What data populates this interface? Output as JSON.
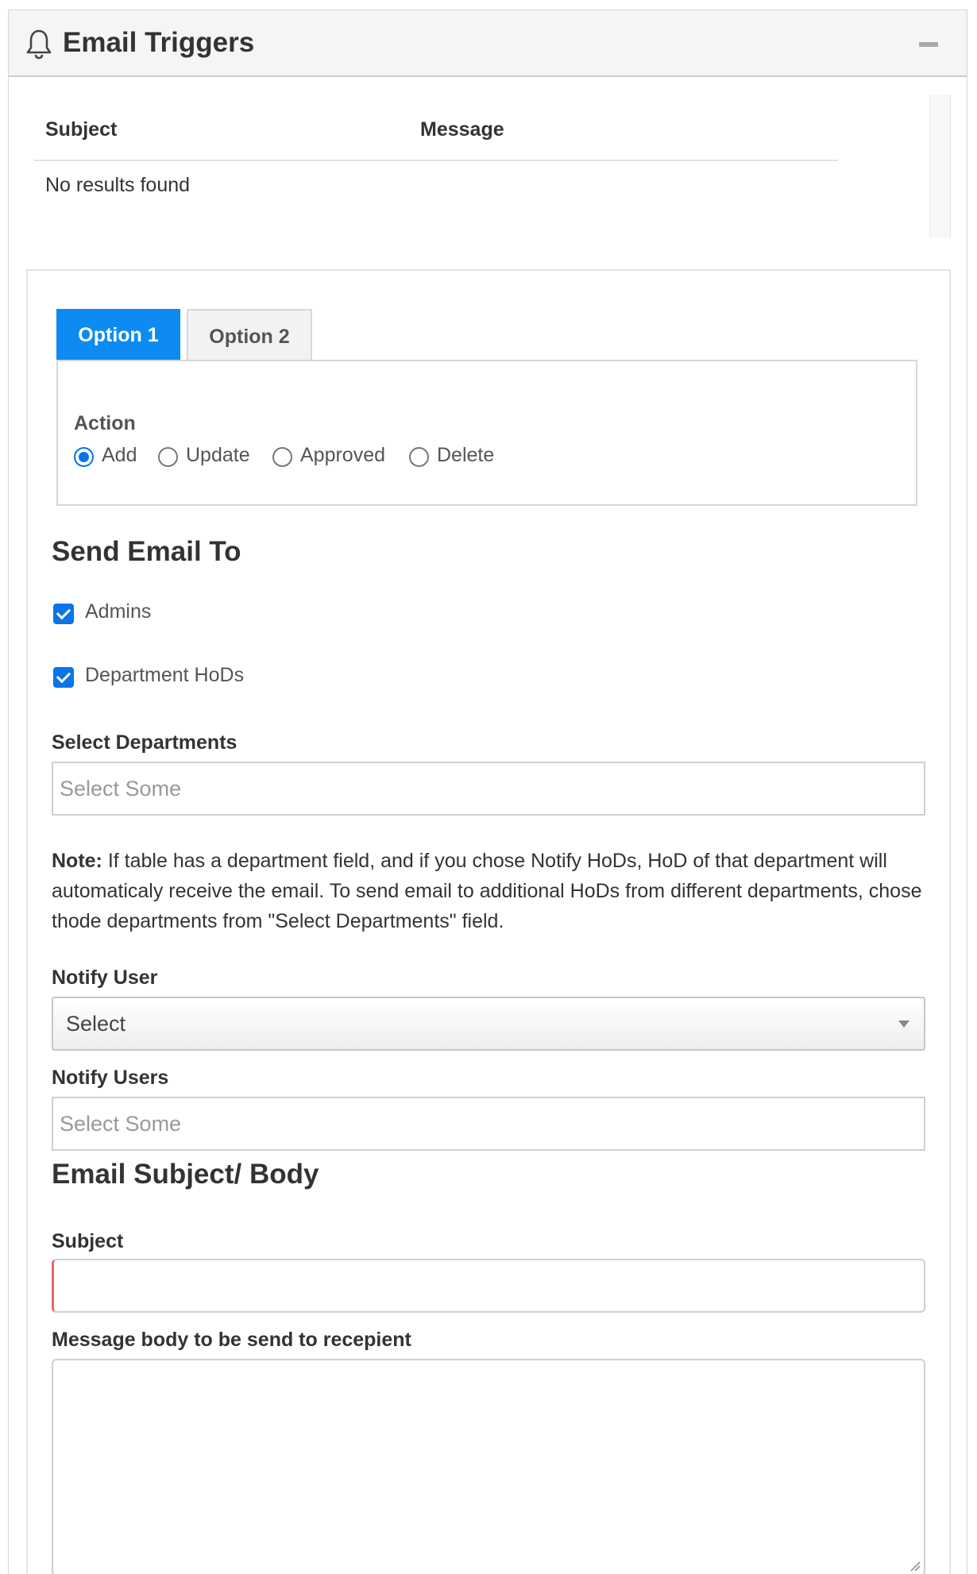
{
  "panel": {
    "title": "Email Triggers",
    "icon": "bell-icon",
    "collapse_icon": "minus-icon"
  },
  "table": {
    "columns": [
      "Subject",
      "Message"
    ],
    "rows": [],
    "empty_text": "No results found"
  },
  "tabs": [
    {
      "label": "Option 1",
      "active": true
    },
    {
      "label": "Option 2",
      "active": false
    }
  ],
  "action": {
    "label": "Action",
    "options": [
      "Add",
      "Update",
      "Approved",
      "Delete"
    ],
    "selected": "Add"
  },
  "send_email_to": {
    "title": "Send Email To",
    "checkboxes": [
      {
        "label": "Admins",
        "checked": true
      },
      {
        "label": "Department HoDs",
        "checked": true
      }
    ]
  },
  "select_departments": {
    "label": "Select Departments",
    "placeholder": "Select Some"
  },
  "note": {
    "prefix": "Note:",
    "text": " If table has a department field, and if you chose Notify HoDs, HoD of that department will automaticaly receive the email. To send email to additional HoDs from different departments, chose thode departments from \"Select Departments\" field."
  },
  "notify_user": {
    "label": "Notify User",
    "value": "Select"
  },
  "notify_users": {
    "label": "Notify Users",
    "placeholder": "Select Some"
  },
  "email_section": {
    "title": "Email Subject/ Body",
    "subject_label": "Subject",
    "subject_value": "",
    "body_label": "Message body to be send to recepient",
    "body_value": ""
  },
  "colors": {
    "accent": "#0d8bf2",
    "checkbox": "#0a74e8",
    "error_border": "#e26a6a"
  }
}
